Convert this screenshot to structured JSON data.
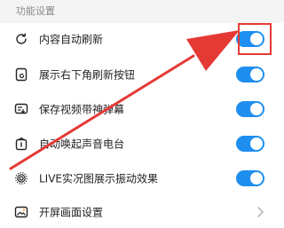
{
  "section": {
    "title": "功能设置"
  },
  "settings": [
    {
      "label": "内容自动刷新",
      "icon": "auto-refresh-icon",
      "control": "toggle",
      "on": true
    },
    {
      "label": "展示右下角刷新按钮",
      "icon": "refresh-button-icon",
      "control": "toggle",
      "on": true
    },
    {
      "label": "保存视频带神弹幕",
      "icon": "video-danmaku-icon",
      "control": "toggle",
      "on": true
    },
    {
      "label": "自动唤起声音电台",
      "icon": "audio-radio-icon",
      "control": "toggle",
      "on": true
    },
    {
      "label": "LIVE实况图展示振动效果",
      "icon": "live-photo-icon",
      "control": "toggle",
      "on": true
    },
    {
      "label": "开屏画面设置",
      "icon": "splash-image-icon",
      "control": "chevron"
    }
  ],
  "colors": {
    "accent": "#1e8ef0",
    "annotation": "#e53935",
    "background": "#f4f4f4"
  }
}
